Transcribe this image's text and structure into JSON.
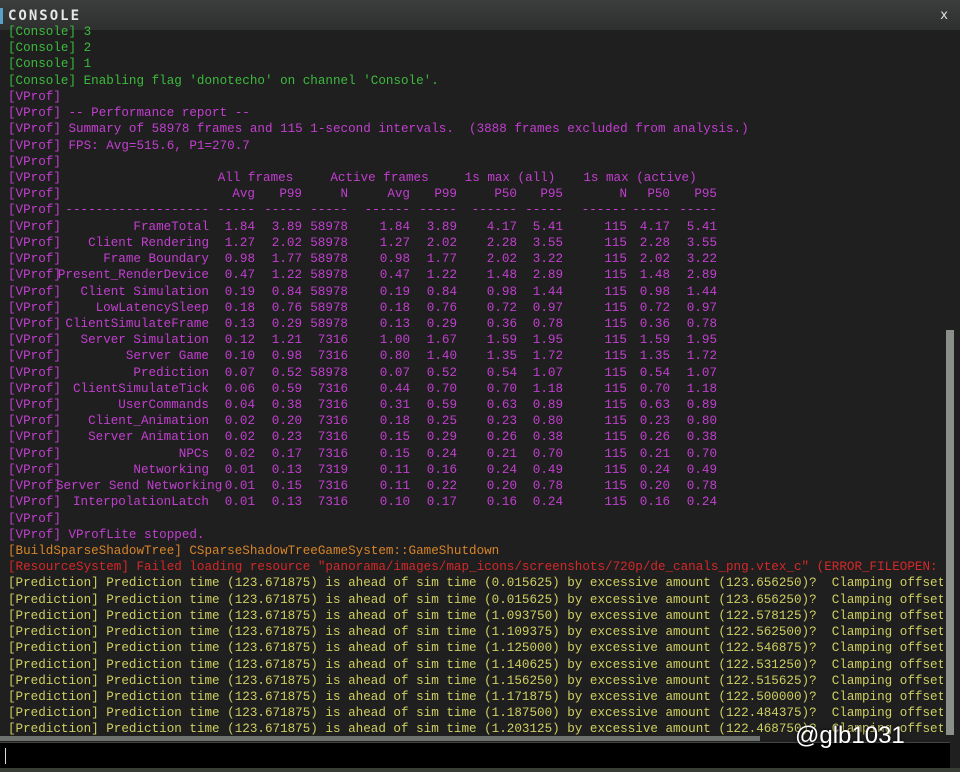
{
  "window": {
    "title": "CONSOLE",
    "close": "x"
  },
  "colors": {
    "console": "#3dba3d",
    "vprof": "#c23fd0",
    "build": "#d7842a",
    "error": "#d52828",
    "prediction": "#cfcf62"
  },
  "pre_lines": [
    {
      "text": "[Console] 3",
      "color": "green"
    },
    {
      "text": "[Console] 2",
      "color": "green"
    },
    {
      "text": "[Console] 1",
      "color": "green"
    },
    {
      "text": "[Console] Enabling flag 'donotecho' on channel 'Console'.",
      "color": "green"
    },
    {
      "text": "[VProf]",
      "color": "mag"
    },
    {
      "text": "[VProf] -- Performance report --",
      "color": "mag"
    },
    {
      "text": "[VProf] Summary of 58978 frames and 115 1-second intervals.  (3888 frames excluded from analysis.)",
      "color": "mag"
    },
    {
      "text": "[VProf] FPS: Avg=515.6, P1=270.7",
      "color": "mag"
    },
    {
      "text": "[VProf]",
      "color": "mag"
    }
  ],
  "table": {
    "prefix": "[VProf]",
    "groups": [
      "All frames",
      "Active frames",
      "1s max (all)",
      "1s max (active)"
    ],
    "columns": [
      "",
      "Avg",
      "P99",
      "N",
      "Avg",
      "P99",
      "P50",
      "P95",
      "N",
      "P50",
      "P95"
    ],
    "rows": [
      [
        "FrameTotal",
        "1.84",
        "3.89",
        "58978",
        "1.84",
        "3.89",
        "4.17",
        "5.41",
        "115",
        "4.17",
        "5.41"
      ],
      [
        "Client Rendering",
        "1.27",
        "2.02",
        "58978",
        "1.27",
        "2.02",
        "2.28",
        "3.55",
        "115",
        "2.28",
        "3.55"
      ],
      [
        "Frame Boundary",
        "0.98",
        "1.77",
        "58978",
        "0.98",
        "1.77",
        "2.02",
        "3.22",
        "115",
        "2.02",
        "3.22"
      ],
      [
        "Present_RenderDevice",
        "0.47",
        "1.22",
        "58978",
        "0.47",
        "1.22",
        "1.48",
        "2.89",
        "115",
        "1.48",
        "2.89"
      ],
      [
        "Client Simulation",
        "0.19",
        "0.84",
        "58978",
        "0.19",
        "0.84",
        "0.98",
        "1.44",
        "115",
        "0.98",
        "1.44"
      ],
      [
        "LowLatencySleep",
        "0.18",
        "0.76",
        "58978",
        "0.18",
        "0.76",
        "0.72",
        "0.97",
        "115",
        "0.72",
        "0.97"
      ],
      [
        "ClientSimulateFrame",
        "0.13",
        "0.29",
        "58978",
        "0.13",
        "0.29",
        "0.36",
        "0.78",
        "115",
        "0.36",
        "0.78"
      ],
      [
        "Server Simulation",
        "0.12",
        "1.21",
        "7316",
        "1.00",
        "1.67",
        "1.59",
        "1.95",
        "115",
        "1.59",
        "1.95"
      ],
      [
        "Server Game",
        "0.10",
        "0.98",
        "7316",
        "0.80",
        "1.40",
        "1.35",
        "1.72",
        "115",
        "1.35",
        "1.72"
      ],
      [
        "Prediction",
        "0.07",
        "0.52",
        "58978",
        "0.07",
        "0.52",
        "0.54",
        "1.07",
        "115",
        "0.54",
        "1.07"
      ],
      [
        "ClientSimulateTick",
        "0.06",
        "0.59",
        "7316",
        "0.44",
        "0.70",
        "0.70",
        "1.18",
        "115",
        "0.70",
        "1.18"
      ],
      [
        "UserCommands",
        "0.04",
        "0.38",
        "7316",
        "0.31",
        "0.59",
        "0.63",
        "0.89",
        "115",
        "0.63",
        "0.89"
      ],
      [
        "Client_Animation",
        "0.02",
        "0.20",
        "7316",
        "0.18",
        "0.25",
        "0.23",
        "0.80",
        "115",
        "0.23",
        "0.80"
      ],
      [
        "Server Animation",
        "0.02",
        "0.23",
        "7316",
        "0.15",
        "0.29",
        "0.26",
        "0.38",
        "115",
        "0.26",
        "0.38"
      ],
      [
        "NPCs",
        "0.02",
        "0.17",
        "7316",
        "0.15",
        "0.24",
        "0.21",
        "0.70",
        "115",
        "0.21",
        "0.70"
      ],
      [
        "Networking",
        "0.01",
        "0.13",
        "7319",
        "0.11",
        "0.16",
        "0.24",
        "0.49",
        "115",
        "0.24",
        "0.49"
      ],
      [
        "Server Send Networking",
        "0.01",
        "0.15",
        "7316",
        "0.11",
        "0.22",
        "0.20",
        "0.78",
        "115",
        "0.20",
        "0.78"
      ],
      [
        "InterpolationLatch",
        "0.01",
        "0.13",
        "7316",
        "0.10",
        "0.17",
        "0.16",
        "0.24",
        "115",
        "0.16",
        "0.24"
      ]
    ]
  },
  "post_lines": [
    {
      "text": "[VProf]",
      "color": "mag"
    },
    {
      "text": "[VProf] VProfLite stopped.",
      "color": "mag"
    },
    {
      "text": "[BuildSparseShadowTree] CSparseShadowTreeGameSystem::GameShutdown",
      "color": "orange"
    },
    {
      "text": "[ResourceSystem] Failed loading resource \"panorama/images/map_icons/screenshots/720p/de_canals_png.vtex_c\" (ERROR_FILEOPEN: File not found)",
      "color": "red"
    },
    {
      "text": "[Prediction] Prediction time (123.671875) is ahead of sim time (0.015625) by excessive amount (123.656250)?  Clamping offset",
      "color": "yellow"
    },
    {
      "text": "[Prediction] Prediction time (123.671875) is ahead of sim time (0.015625) by excessive amount (123.656250)?  Clamping offset",
      "color": "yellow"
    },
    {
      "text": "[Prediction] Prediction time (123.671875) is ahead of sim time (1.093750) by excessive amount (122.578125)?  Clamping offset",
      "color": "yellow"
    },
    {
      "text": "[Prediction] Prediction time (123.671875) is ahead of sim time (1.109375) by excessive amount (122.562500)?  Clamping offset",
      "color": "yellow"
    },
    {
      "text": "[Prediction] Prediction time (123.671875) is ahead of sim time (1.125000) by excessive amount (122.546875)?  Clamping offset",
      "color": "yellow"
    },
    {
      "text": "[Prediction] Prediction time (123.671875) is ahead of sim time (1.140625) by excessive amount (122.531250)?  Clamping offset",
      "color": "yellow"
    },
    {
      "text": "[Prediction] Prediction time (123.671875) is ahead of sim time (1.156250) by excessive amount (122.515625)?  Clamping offset",
      "color": "yellow"
    },
    {
      "text": "[Prediction] Prediction time (123.671875) is ahead of sim time (1.171875) by excessive amount (122.500000)?  Clamping offset",
      "color": "yellow"
    },
    {
      "text": "[Prediction] Prediction time (123.671875) is ahead of sim time (1.187500) by excessive amount (122.484375)?  Clamping offset",
      "color": "yellow"
    },
    {
      "text": "[Prediction] Prediction time (123.671875) is ahead of sim time (1.203125) by excessive amount (122.468750)?  Clamping offset",
      "color": "yellow"
    }
  ],
  "input": {
    "value": ""
  },
  "watermark": "@glb1031"
}
